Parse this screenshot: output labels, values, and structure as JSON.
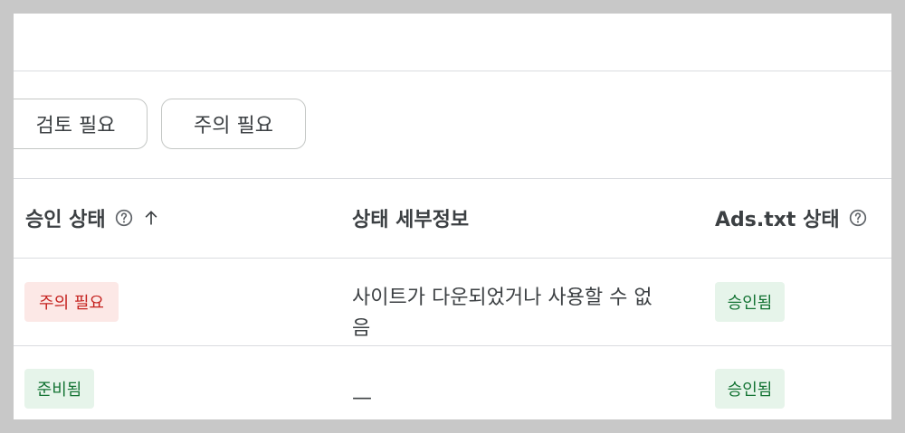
{
  "filters": [
    {
      "label": "검토 필요"
    },
    {
      "label": "주의 필요"
    }
  ],
  "table": {
    "headers": {
      "approval_status": "승인 상태",
      "status_details": "상태 세부정보",
      "ads_txt_status": "Ads.txt 상태"
    },
    "rows": [
      {
        "approval_status": "주의 필요",
        "status_details": "사이트가 다운되었거나 사용할 수 없음",
        "ads_txt_status": "승인됨"
      },
      {
        "approval_status": "준비됨",
        "status_details": "—",
        "ads_txt_status": "승인됨"
      }
    ]
  },
  "colors": {
    "attention_badge_bg": "#fce8e6",
    "attention_badge_text": "#c5221f",
    "ok_badge_bg": "#e6f4ea",
    "ok_badge_text": "#137333"
  },
  "icons": {
    "help": "help-icon",
    "sort": "sort-ascending-icon"
  }
}
